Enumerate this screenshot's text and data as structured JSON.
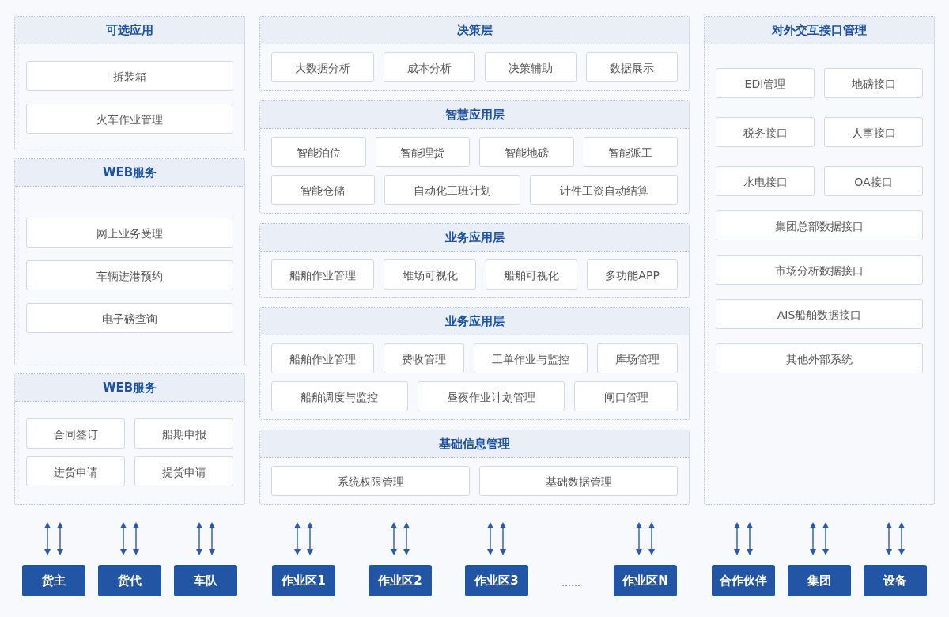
{
  "columns": [
    {
      "panels": [
        {
          "title": "可选应用",
          "rows": [
            {
              "modules": [
                "拆装箱"
              ]
            },
            {
              "modules": [
                "火车作业管理"
              ]
            }
          ]
        },
        {
          "title": "WEB服务",
          "rows": [
            {
              "modules": [
                "网上业务受理"
              ]
            },
            {
              "modules": [
                "车辆进港预约"
              ]
            },
            {
              "modules": [
                "电子磅查询"
              ]
            }
          ]
        },
        {
          "title": "WEB服务",
          "rows": [
            {
              "modules": [
                "合同签订",
                "船期申报"
              ]
            },
            {
              "modules": [
                "进货申请",
                "提货申请"
              ]
            }
          ]
        }
      ]
    },
    {
      "panels": [
        {
          "title": "决策层",
          "rows": [
            {
              "modules": [
                "大数据分析",
                "成本分析",
                "决策辅助",
                "数据展示"
              ]
            }
          ]
        },
        {
          "title": "智慧应用层",
          "rows": [
            {
              "modules": [
                "智能泊位",
                "智能理货",
                "智能地磅",
                "智能派工"
              ]
            },
            {
              "modules": [
                "智能仓储",
                "自动化工班计划",
                "计件工资自动结算"
              ]
            }
          ]
        },
        {
          "title": "业务应用层",
          "rows": [
            {
              "modules": [
                "船舶作业管理",
                "堆场可视化",
                "船舶可视化",
                "多功能APP"
              ]
            }
          ]
        },
        {
          "title": "业务应用层",
          "rows": [
            {
              "modules": [
                "船舶作业管理",
                "费收管理",
                "工单作业与监控",
                "库场管理"
              ]
            },
            {
              "modules": [
                "船舶调度与监控",
                "昼夜作业计划管理",
                "闸口管理"
              ]
            }
          ]
        },
        {
          "title": "基础信息管理",
          "rows": [
            {
              "modules": [
                "系统权限管理",
                "基础数据管理"
              ]
            }
          ]
        }
      ]
    },
    {
      "panels": [
        {
          "title": "对外交互接口管理",
          "rows": [
            {
              "modules": [
                "EDI管理",
                "地磅接口"
              ]
            },
            {
              "modules": [
                "税务接口",
                "人事接口"
              ]
            },
            {
              "modules": [
                "水电接口",
                "OA接口"
              ]
            },
            {
              "modules": [
                "集团总部数据接口"
              ]
            },
            {
              "modules": [
                "市场分析数据接口"
              ]
            },
            {
              "modules": [
                "AIS船舶数据接口"
              ]
            },
            {
              "modules": [
                "其他外部系统"
              ]
            }
          ]
        }
      ]
    }
  ],
  "terminals": [
    {
      "items": [
        {
          "kind": "box",
          "label": "货主"
        },
        {
          "kind": "box",
          "label": "货代"
        },
        {
          "kind": "box",
          "label": "车队"
        }
      ]
    },
    {
      "items": [
        {
          "kind": "box",
          "label": "作业区1"
        },
        {
          "kind": "box",
          "label": "作业区2"
        },
        {
          "kind": "box",
          "label": "作业区3"
        },
        {
          "kind": "ellipsis",
          "label": "……"
        },
        {
          "kind": "box",
          "label": "作业区N"
        }
      ]
    },
    {
      "items": [
        {
          "kind": "box",
          "label": "合作伙伴"
        },
        {
          "kind": "box",
          "label": "集团"
        },
        {
          "kind": "box",
          "label": "设备"
        }
      ]
    }
  ]
}
